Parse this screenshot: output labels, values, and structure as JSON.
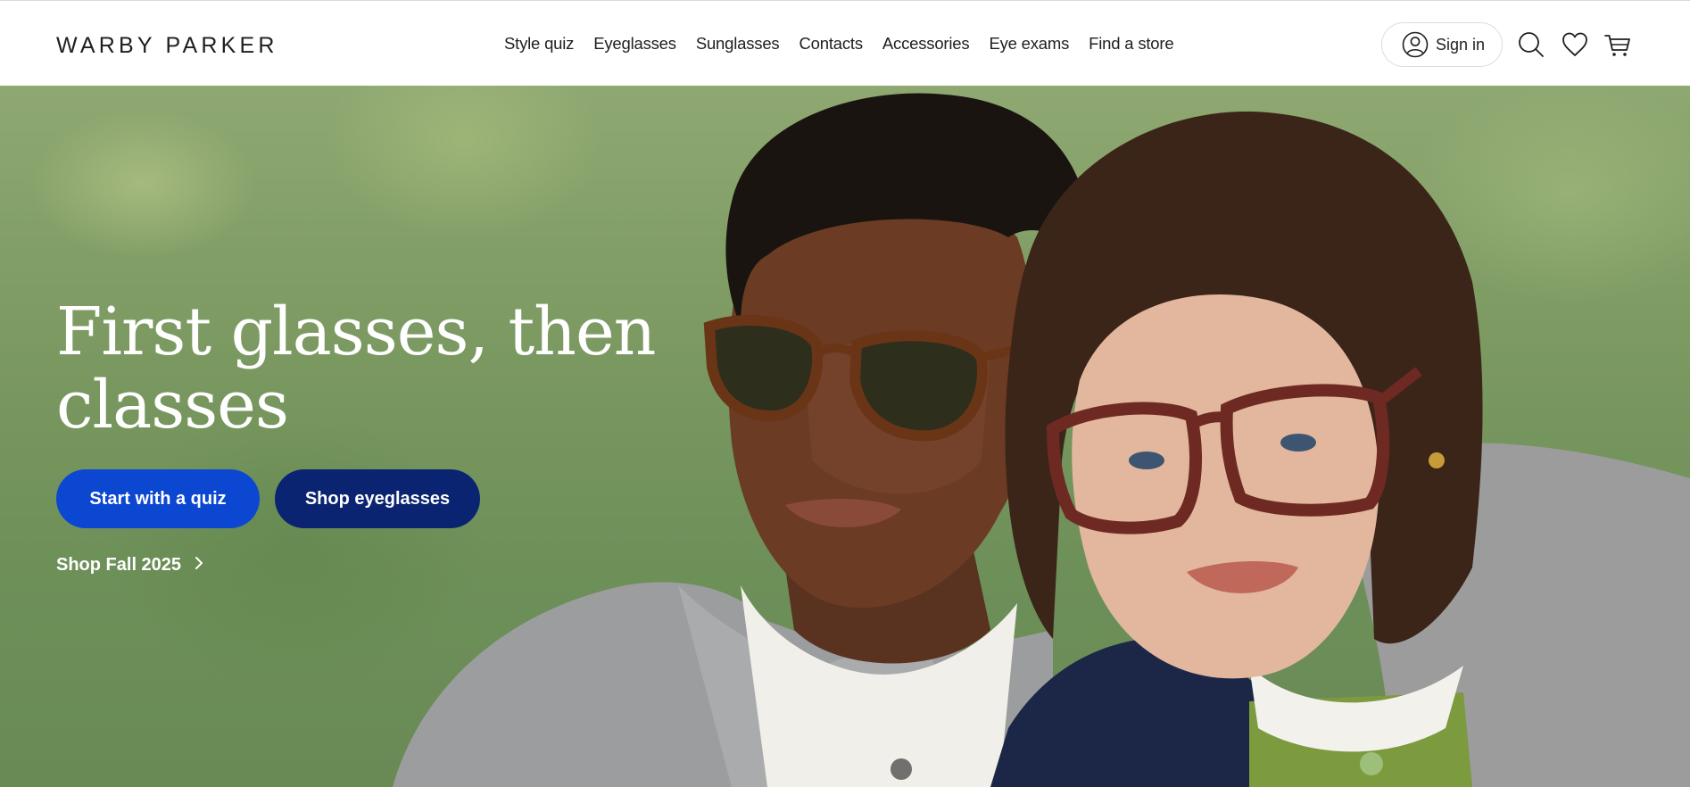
{
  "header": {
    "logo": "WARBY PARKER",
    "nav": [
      {
        "label": "Style quiz"
      },
      {
        "label": "Eyeglasses"
      },
      {
        "label": "Sunglasses"
      },
      {
        "label": "Contacts"
      },
      {
        "label": "Accessories"
      },
      {
        "label": "Eye exams"
      },
      {
        "label": "Find a store"
      }
    ],
    "sign_in_label": "Sign in",
    "icons": [
      "user-icon",
      "search-icon",
      "heart-icon",
      "cart-icon"
    ]
  },
  "hero": {
    "title": "First glasses, then classes",
    "primary_button": "Start with a quiz",
    "secondary_button": "Shop eyeglasses",
    "link_label": "Shop Fall 2025",
    "colors": {
      "primary_button": "#0c47d1",
      "secondary_button": "#0a2471",
      "text": "#ffffff"
    }
  }
}
